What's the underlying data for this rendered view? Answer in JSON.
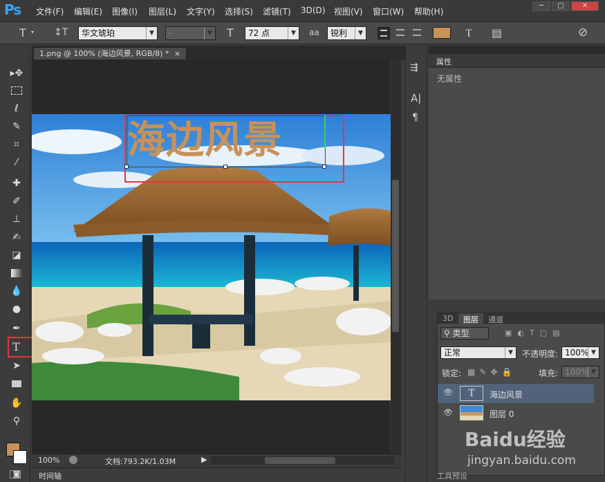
{
  "app": {
    "logo": "Ps"
  },
  "menu": [
    "文件(F)",
    "编辑(E)",
    "图像(I)",
    "图层(L)",
    "文字(Y)",
    "选择(S)",
    "滤镜(T)",
    "3D(D)",
    "视图(V)",
    "窗口(W)",
    "帮助(H)"
  ],
  "window_buttons": [
    "─",
    "□",
    "✕"
  ],
  "options": {
    "tool_icon": "T",
    "orient_icon": "↕T",
    "font_family": "华文琥珀",
    "font_style": "-",
    "size_icon": "T",
    "font_size": "72 点",
    "aa_icon": "aa",
    "antialias": "锐利",
    "text_color": "#c8915a",
    "warp_icon": "Ⲧ",
    "panel_icon": "▤",
    "cancel_icon": "⊘"
  },
  "document": {
    "tab_title": "1.png @ 100% (海边风景, RGB/8) *",
    "tab_close": "×",
    "text_layer": "海边风景",
    "text_color": "#c8915a"
  },
  "status": {
    "zoom": "100%",
    "doc_info": "文档:793.2K/1.03M"
  },
  "timeline_label": "时间轴",
  "properties": {
    "title": "属性",
    "content": "无属性"
  },
  "layers_panel": {
    "tabs": [
      "3D",
      "图层",
      "通道"
    ],
    "active_tab": "图层",
    "filter_label": "类型",
    "blend_mode": "正常",
    "opacity_label": "不透明度:",
    "opacity": "100%",
    "lock_label": "锁定:",
    "fill_label": "填充:",
    "fill": "100%",
    "layers": [
      {
        "name": "海边风景",
        "kind": "text"
      },
      {
        "name": "图层 0",
        "kind": "image"
      }
    ]
  },
  "watermark": {
    "brand": "Baidu经验",
    "url": "jingyan.baidu.com"
  },
  "bottom_panel_label": "工具预设",
  "colors": {
    "accent_red": "#e8343f",
    "selection_blue": "#51637a"
  }
}
